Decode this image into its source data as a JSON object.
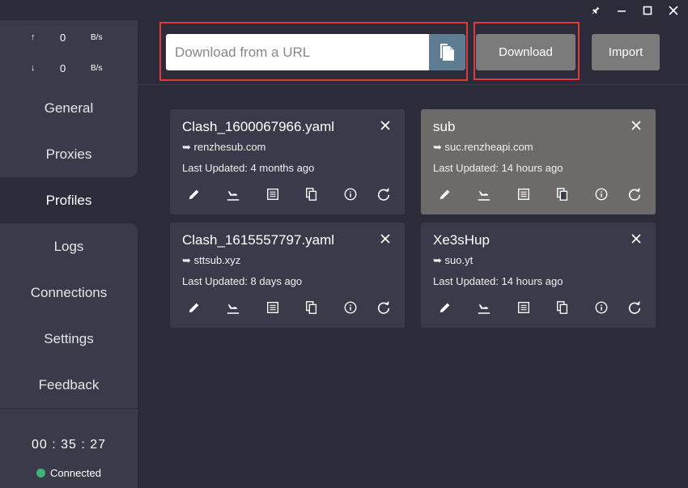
{
  "window": {
    "pin_icon": "pin-icon",
    "minimize_icon": "minimize-icon",
    "maximize_icon": "maximize-icon",
    "close_icon": "close-icon"
  },
  "traffic": {
    "up": {
      "arrow": "↑",
      "value": "0",
      "unit": "B/s"
    },
    "down": {
      "arrow": "↓",
      "value": "0",
      "unit": "B/s"
    }
  },
  "sidebar": {
    "items": [
      {
        "label": "General"
      },
      {
        "label": "Proxies"
      },
      {
        "label": "Profiles",
        "active": true
      },
      {
        "label": "Logs"
      },
      {
        "label": "Connections"
      },
      {
        "label": "Settings"
      },
      {
        "label": "Feedback"
      }
    ]
  },
  "status": {
    "timer": "00 : 35 : 27",
    "connection": "Connected",
    "connection_color": "#40b27a"
  },
  "toolbar": {
    "url_placeholder": "Download from a URL",
    "url_value": "",
    "download_label": "Download",
    "import_label": "Import",
    "highlight_color": "#e03a3a"
  },
  "profiles": [
    {
      "name": "Clash_1600067966.yaml",
      "source": "➥ renzhesub.com",
      "updated": "Last Updated: 4 months ago",
      "selected": false
    },
    {
      "name": "sub",
      "source": "➥ suc.renzheapi.com",
      "updated": "Last Updated: 14 hours ago",
      "selected": true
    },
    {
      "name": "Clash_1615557797.yaml",
      "source": "➥ sttsub.xyz",
      "updated": "Last Updated: 8 days ago",
      "selected": false
    },
    {
      "name": "Xe3sHup",
      "source": "➥ suo.yt",
      "updated": "Last Updated: 14 hours ago",
      "selected": false
    }
  ],
  "card_actions": [
    "edit-icon",
    "flight-land-icon",
    "list-icon",
    "copy-icon",
    "info-icon",
    "refresh-icon"
  ]
}
